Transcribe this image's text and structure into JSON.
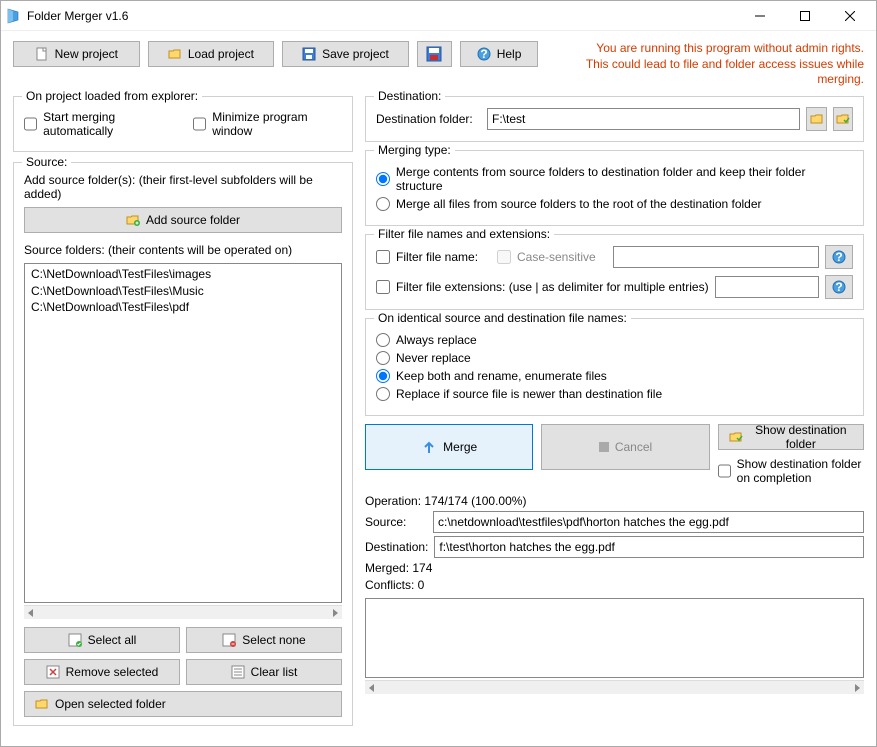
{
  "window": {
    "title": "Folder Merger v1.6"
  },
  "toolbar": {
    "new_project": "New project",
    "load_project": "Load project",
    "save_project": "Save project",
    "help": "Help"
  },
  "warning": {
    "line1": "You are running this program without admin rights.",
    "line2": "This could lead to file and folder access issues while merging."
  },
  "explorer_group": {
    "title": "On project loaded from explorer:",
    "start_auto": "Start merging automatically",
    "minimize": "Minimize program window"
  },
  "source_group": {
    "title": "Source:",
    "add_hint": "Add source folder(s): (their first-level subfolders will be added)",
    "add_btn": "Add source folder",
    "list_hint": "Source folders: (their contents will be operated on)",
    "folders": [
      "C:\\NetDownload\\TestFiles\\images",
      "C:\\NetDownload\\TestFiles\\Music",
      "C:\\NetDownload\\TestFiles\\pdf"
    ],
    "select_all": "Select all",
    "select_none": "Select none",
    "remove_selected": "Remove selected",
    "clear_list": "Clear list",
    "open_selected": "Open selected folder"
  },
  "destination_group": {
    "title": "Destination:",
    "label": "Destination folder:",
    "value": "F:\\test"
  },
  "merging_type": {
    "title": "Merging type:",
    "opt_keep": "Merge contents from source folders to destination folder and keep their folder structure",
    "opt_root": "Merge all files from source folders to the root of the destination folder"
  },
  "filter_group": {
    "title": "Filter file names and extensions:",
    "filter_name": "Filter file name:",
    "case_sensitive": "Case-sensitive",
    "filter_ext": "Filter file extensions: (use | as delimiter for multiple entries)"
  },
  "identical_group": {
    "title": "On identical source and destination file names:",
    "always": "Always replace",
    "never": "Never replace",
    "keep_both": "Keep both and rename, enumerate files",
    "newer": "Replace if source file is newer than destination file"
  },
  "actions": {
    "merge": "Merge",
    "cancel": "Cancel",
    "show_dest": "Show destination folder",
    "show_on_complete": "Show destination folder on completion"
  },
  "status": {
    "operation": "Operation:  174/174 (100.00%)",
    "source_lbl": "Source:",
    "source_val": "c:\\netdownload\\testfiles\\pdf\\horton hatches the egg.pdf",
    "dest_lbl": "Destination:",
    "dest_val": "f:\\test\\horton hatches the egg.pdf",
    "merged": "Merged:  174",
    "conflicts": "Conflicts:  0"
  }
}
